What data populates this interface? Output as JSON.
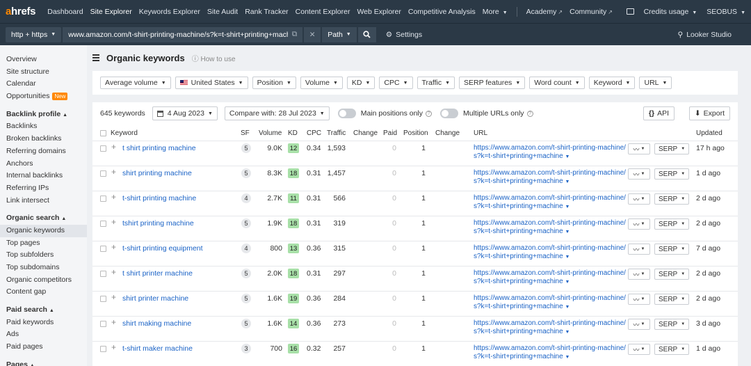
{
  "topnav": {
    "logo_a": "a",
    "logo_rest": "hrefs",
    "items": [
      "Dashboard",
      "Site Explorer",
      "Keywords Explorer",
      "Site Audit",
      "Rank Tracker",
      "Content Explorer",
      "Web Explorer",
      "Competitive Analysis",
      "More"
    ],
    "ext_items": [
      "Academy",
      "Community"
    ],
    "credits": "Credits usage",
    "account": "SEOBUS"
  },
  "urlbar": {
    "protocol": "http + https",
    "url": "www.amazon.com/t-shirt-printing-machine/s?k=t-shirt+printing+machin",
    "mode": "Path",
    "settings": "Settings",
    "looker": "Looker Studio"
  },
  "sidebar": {
    "top": [
      "Overview",
      "Site structure",
      "Calendar",
      "Opportunities"
    ],
    "new_badge": "New",
    "sections": [
      {
        "title": "Backlink profile",
        "items": [
          "Backlinks",
          "Broken backlinks",
          "Referring domains",
          "Anchors",
          "Internal backlinks",
          "Referring IPs",
          "Link intersect"
        ]
      },
      {
        "title": "Organic search",
        "items": [
          "Organic keywords",
          "Top pages",
          "Top subfolders",
          "Top subdomains",
          "Organic competitors",
          "Content gap"
        ]
      },
      {
        "title": "Paid search",
        "items": [
          "Paid keywords",
          "Ads",
          "Paid pages"
        ]
      },
      {
        "title": "Pages",
        "items": []
      }
    ]
  },
  "page": {
    "title": "Organic keywords",
    "howto": "How to use"
  },
  "filters": [
    "Average volume",
    "United States",
    "Position",
    "Volume",
    "KD",
    "CPC",
    "Traffic",
    "SERP features",
    "Word count",
    "Keyword",
    "URL"
  ],
  "toolbar": {
    "count": "645 keywords",
    "date": "4 Aug 2023",
    "compare": "Compare with: 28 Jul 2023",
    "main_positions": "Main positions only",
    "multiple_urls": "Multiple URLs only",
    "api": "API",
    "export": "Export"
  },
  "columns": [
    "Keyword",
    "SF",
    "Volume",
    "KD",
    "CPC",
    "Traffic",
    "Change",
    "Paid",
    "Position",
    "Change",
    "URL",
    "Updated"
  ],
  "url_line1": "https://www.amazon.com/t-shirt-printing-machine/",
  "url_line2": "s?k=t-shirt+printing+machine",
  "serp_label": "SERP",
  "rows": [
    {
      "kw": "t shirt printing machine",
      "sf": "5",
      "vol": "9.0K",
      "kd": "12",
      "kd_color": "#a8e0a8",
      "cpc": "0.34",
      "traffic": "1,593",
      "paid": "0",
      "pos": "1",
      "updated": "17 h ago"
    },
    {
      "kw": "shirt printing machine",
      "sf": "5",
      "vol": "8.3K",
      "kd": "18",
      "kd_color": "#a8e0a8",
      "cpc": "0.31",
      "traffic": "1,457",
      "paid": "0",
      "pos": "1",
      "updated": "1 d ago"
    },
    {
      "kw": "t-shirt printing machine",
      "sf": "4",
      "vol": "2.7K",
      "kd": "11",
      "kd_color": "#a8e0a8",
      "cpc": "0.31",
      "traffic": "566",
      "paid": "0",
      "pos": "1",
      "updated": "2 d ago"
    },
    {
      "kw": "tshirt printing machine",
      "sf": "5",
      "vol": "1.9K",
      "kd": "18",
      "kd_color": "#a8e0a8",
      "cpc": "0.31",
      "traffic": "319",
      "paid": "0",
      "pos": "1",
      "updated": "2 d ago"
    },
    {
      "kw": "t-shirt printing equipment",
      "sf": "4",
      "vol": "800",
      "kd": "13",
      "kd_color": "#a8e0a8",
      "cpc": "0.36",
      "traffic": "315",
      "paid": "0",
      "pos": "1",
      "updated": "7 d ago"
    },
    {
      "kw": "t shirt printer machine",
      "sf": "5",
      "vol": "2.0K",
      "kd": "18",
      "kd_color": "#a8e0a8",
      "cpc": "0.31",
      "traffic": "297",
      "paid": "0",
      "pos": "1",
      "updated": "2 d ago"
    },
    {
      "kw": "shirt printer machine",
      "sf": "5",
      "vol": "1.6K",
      "kd": "19",
      "kd_color": "#a8e0a8",
      "cpc": "0.36",
      "traffic": "284",
      "paid": "0",
      "pos": "1",
      "updated": "2 d ago"
    },
    {
      "kw": "shirt making machine",
      "sf": "5",
      "vol": "1.6K",
      "kd": "14",
      "kd_color": "#a8e0a8",
      "cpc": "0.36",
      "traffic": "273",
      "paid": "0",
      "pos": "1",
      "updated": "3 d ago"
    },
    {
      "kw": "t-shirt maker machine",
      "sf": "3",
      "vol": "700",
      "kd": "16",
      "kd_color": "#a8e0a8",
      "cpc": "0.32",
      "traffic": "257",
      "paid": "0",
      "pos": "1",
      "updated": "1 d ago"
    }
  ]
}
